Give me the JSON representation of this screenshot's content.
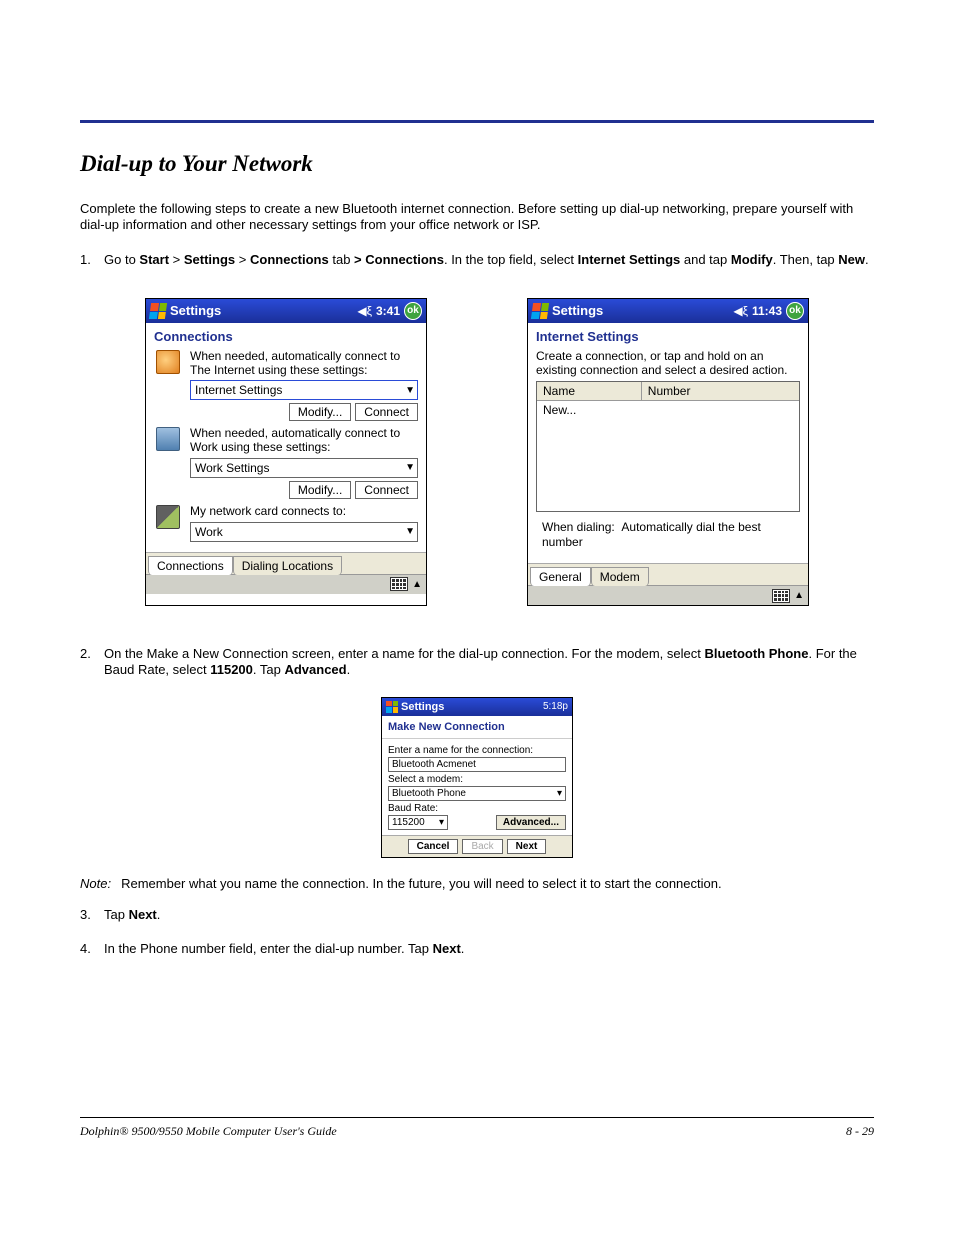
{
  "heading": "Dial-up to Your Network",
  "intro": "Complete the following steps to create a new Bluetooth internet connection. Before setting up dial-up networking, prepare yourself with dial-up information and other necessary settings from your office network or ISP.",
  "steps": {
    "s1_num": "1.",
    "s1_pre": "Go to ",
    "s1_b1": "Start",
    "s1_gt1": " > ",
    "s1_b2": "Settings",
    "s1_gt2": " > ",
    "s1_b3": "Connections",
    "s1_mid1": " tab ",
    "s1_b4": "> Connections",
    "s1_mid2": ". In the top field, select ",
    "s1_b5": "Internet Settings",
    "s1_mid3": " and tap ",
    "s1_b6": "Modify",
    "s1_mid4": ". Then, tap ",
    "s1_b7": "New",
    "s1_end": ".",
    "s2_num": "2.",
    "s2_pre": "On the Make a New Connection screen, enter a name for the dial-up connection. For the modem, select ",
    "s2_b1": "Bluetooth Phone",
    "s2_mid1": ". For the Baud Rate, select ",
    "s2_b2": "115200",
    "s2_mid2": ". Tap ",
    "s2_b3": "Advanced",
    "s2_end": ".",
    "s3_num": "3.",
    "s3_pre": "Tap ",
    "s3_b1": "Next",
    "s3_end": ".",
    "s4_num": "4.",
    "s4_pre": "In the Phone number field, enter the dial-up number. Tap ",
    "s4_b1": "Next",
    "s4_end": "."
  },
  "note_label": "Note:",
  "note_text": "Remember what you name the connection. In the future, you will need to select it to start the connection.",
  "screen1": {
    "title": "Settings",
    "time": "3:41",
    "ok": "ok",
    "subtitle": "Connections",
    "sec1_text": "When needed, automatically connect to The Internet using these settings:",
    "sec1_ddl": "Internet Settings",
    "btn_modify": "Modify...",
    "btn_connect": "Connect",
    "sec2_text": "When needed, automatically connect to Work using these settings:",
    "sec2_ddl": "Work Settings",
    "sec3_text": "My network card connects to:",
    "sec3_ddl": "Work",
    "tab1": "Connections",
    "tab2": "Dialing Locations"
  },
  "screen2": {
    "title": "Settings",
    "time": "11:43",
    "ok": "ok",
    "subtitle": "Internet Settings",
    "instr": "Create a connection, or tap and hold on an existing connection and select a desired action.",
    "col_name": "Name",
    "col_number": "Number",
    "row_new": "New...",
    "dialing_label": "When dialing:",
    "dialing_value": "Automatically dial the best number",
    "tab1": "General",
    "tab2": "Modem"
  },
  "screen3": {
    "title": "Settings",
    "time": "5:18p",
    "subtitle": "Make New Connection",
    "lbl_name": "Enter a name for the connection:",
    "val_name": "Bluetooth Acmenet",
    "lbl_modem": "Select a modem:",
    "val_modem": "Bluetooth Phone",
    "lbl_baud": "Baud Rate:",
    "val_baud": "115200",
    "btn_advanced": "Advanced...",
    "btn_cancel": "Cancel",
    "btn_back": "Back",
    "btn_next": "Next"
  },
  "footer_left": "Dolphin® 9500/9550 Mobile Computer User's Guide",
  "footer_right": "8 - 29"
}
